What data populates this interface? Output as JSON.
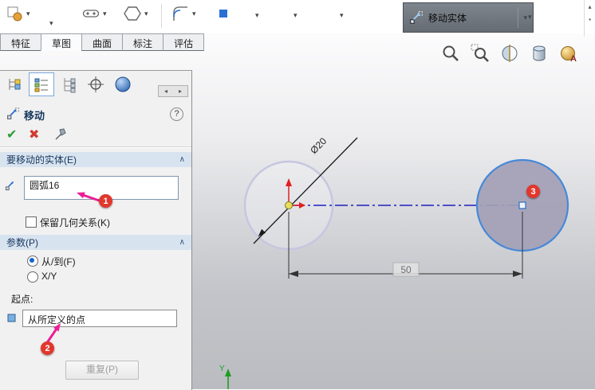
{
  "ribbon": {
    "move_button_label": "移动实体"
  },
  "icons": {
    "caret": "▾",
    "collapse": "∧",
    "check": "✔",
    "cross": "✖",
    "help": "?",
    "tab_prev": "◂",
    "tab_next": "▸",
    "overflow_up": "▴",
    "overflow_dot": "▪"
  },
  "tabs": [
    {
      "label": "特征"
    },
    {
      "label": "草图"
    },
    {
      "label": "曲面"
    },
    {
      "label": "标注"
    },
    {
      "label": "评估"
    }
  ],
  "panel": {
    "title": "移动",
    "entities": {
      "header": "要移动的实体(E)",
      "selected_entity": "圆弧16",
      "keep_relations": "保留几何关系(K)"
    },
    "parameters": {
      "header": "参数(P)",
      "from_to": "从/到(F)",
      "xy": "X/Y",
      "start_point_label": "起点:",
      "start_point_value": "从所定义的点",
      "repeat_button": "重复(P)"
    }
  },
  "badges": {
    "one": "1",
    "two": "2",
    "three": "3"
  },
  "sketch": {
    "diameter_dimension": "Ø20",
    "distance_dimension": "50",
    "axis_label": "Y"
  }
}
